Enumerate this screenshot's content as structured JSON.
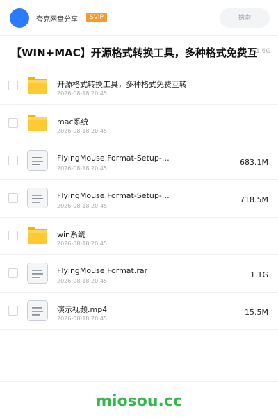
{
  "header": {
    "share_name": "夸克网盘分享",
    "badge": "SVIP",
    "search_placeholder": "搜索",
    "accent_color": "#2b7bff",
    "badge_color": "#f59b2b"
  },
  "folder": {
    "title": "【WIN+MAC】开源格式转换工具，多种格式免费互转",
    "total_size": "1.6G"
  },
  "items": [
    {
      "type": "folder",
      "icon": "folder-icon",
      "name": "开源格式转换工具，多种格式免费互转",
      "date": "2026-08-18 20:45",
      "size": ""
    },
    {
      "type": "folder",
      "icon": "folder-icon",
      "name": "mac系统",
      "date": "2026-08-18 20:45",
      "size": ""
    },
    {
      "type": "file",
      "icon": "document-icon",
      "name": "FlyingMouse.Format-Setup-…",
      "date": "2026-08-18 20:45",
      "size": "683.1M"
    },
    {
      "type": "file",
      "icon": "document-icon",
      "name": "FlyingMouse.Format-Setup-…",
      "date": "2026-08-18 20:45",
      "size": "718.5M"
    },
    {
      "type": "folder",
      "icon": "folder-icon",
      "name": "win系统",
      "date": "2026-08-18 20:45",
      "size": ""
    },
    {
      "type": "file",
      "icon": "document-icon",
      "name": "FlyingMouse Format.rar",
      "date": "2026-08-18 20:45",
      "size": "1.1G"
    },
    {
      "type": "file",
      "icon": "document-icon",
      "name": "演示视频.mp4",
      "date": "2026-08-18 20:45",
      "size": "15.5M"
    }
  ],
  "footer": {
    "watermark": "miosou.cc",
    "watermark_color": "#35b84a"
  }
}
